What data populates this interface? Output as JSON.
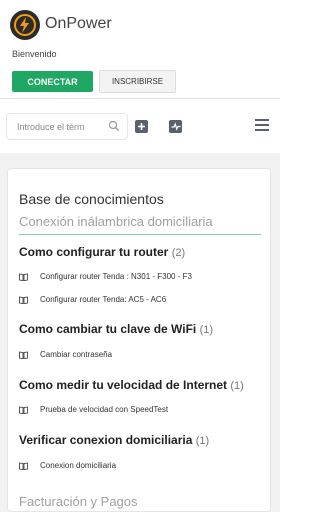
{
  "header": {
    "brand": "OnPower",
    "welcome": "Bienvenido",
    "connect_label": "CONECTAR",
    "signup_label": "INSCRIBIRSE"
  },
  "toolbar": {
    "search_placeholder": "Introduce el térm"
  },
  "kb": {
    "title": "Base de conocimientos",
    "section": "Conexión inálambrica domiciliaria",
    "categories": [
      {
        "title": "Como configurar tu router",
        "count": "(2)",
        "articles": [
          "Configurar router Tenda : N301 - F300 - F3",
          "Configurar router Tenda: AC5 - AC6"
        ]
      },
      {
        "title": "Como cambiar tu clave de WiFi",
        "count": "(1)",
        "articles": [
          "Cambiar contraseña"
        ]
      },
      {
        "title": "Como medir tu velocidad de Internet",
        "count": "(1)",
        "articles": [
          "Prueba de velocidad con SpeedTest"
        ]
      },
      {
        "title": "Verificar conexion domiciliaria",
        "count": "(1)",
        "articles": [
          "Conexion domiciliaria"
        ]
      }
    ],
    "next_section": "Facturación y Pagos"
  },
  "colors": {
    "accent": "#1ea864",
    "icon": "#5a6070"
  }
}
